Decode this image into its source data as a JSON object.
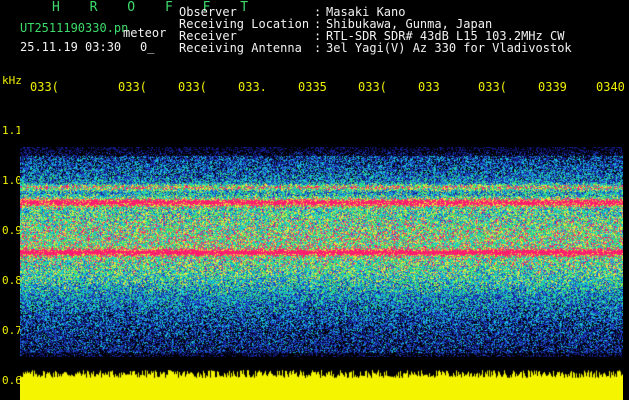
{
  "app": {
    "title": "H R O F F T"
  },
  "file": {
    "filename": "UT2511190330.pn",
    "tag": "meteor",
    "datetime": "25.11.19 03:30",
    "counter": "0_"
  },
  "info": {
    "rows": [
      {
        "label": "Observer",
        "value": "Masaki Kano"
      },
      {
        "label": "Receiving Location",
        "value": "Shibukawa, Gunma, Japan"
      },
      {
        "label": "Receiver",
        "value": "RTL-SDR SDR# 43dB L15 103.2MHz CW"
      },
      {
        "label": "Receiving Antenna",
        "value": "3el Yagi(V) Az 330 for Vladivostok"
      }
    ],
    "separator": ":"
  },
  "axes": {
    "y_unit": "kHz",
    "y_ticks": [
      "1.1",
      "1.0",
      "0.9",
      "0.8",
      "0.7",
      "0.6"
    ],
    "x_ticks": [
      "033(",
      "033(",
      "033(",
      "033.",
      "0335",
      "033(",
      "033",
      "033(",
      "0339",
      "0340"
    ]
  },
  "spectrogram": {
    "freq_range_khz": [
      0.73,
      1.06
    ],
    "bright_bands_khz": [
      0.955,
      0.86
    ],
    "colors": {
      "background": "#000000",
      "low": "#1a2a9c",
      "mid": "#19c9d8",
      "high": "#2fe06a",
      "hot": "#ff1f6e",
      "level": "#f5f500"
    }
  }
}
